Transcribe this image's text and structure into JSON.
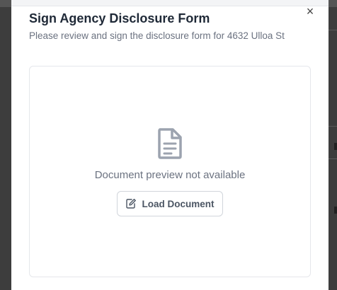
{
  "dialog": {
    "title": "Sign Agency Disclosure Form",
    "subtitle": "Please review and sign the disclosure form for 4632 Ulloa St",
    "close_label": "×"
  },
  "document": {
    "icon": "document-icon",
    "preview_message": "Document preview not available",
    "load_button_label": "Load Document",
    "load_button_icon": "edit-document-icon"
  },
  "colors": {
    "title": "#1f2937",
    "muted_text": "#6b7280",
    "border": "#e5e7eb",
    "icon": "#9ca3af"
  }
}
